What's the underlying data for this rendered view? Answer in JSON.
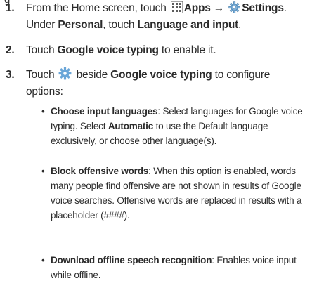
{
  "icons": {
    "apps": "apps-grid-icon",
    "settings": "settings-gear-icon",
    "configure": "configure-gear-icon"
  },
  "colors": {
    "text": "#2b2b2b",
    "apps_icon": "#5b5b5b",
    "settings_icon": "#6fa8d6",
    "configure_icon": "#6aa6d8"
  },
  "steps": [
    {
      "number": "1.",
      "line1_pre": "From the Home screen, touch ",
      "apps": "Apps",
      "arrow": " → ",
      "settings": "Settings",
      "period": ".",
      "line2_pre": "Under ",
      "personal": "Personal",
      "line2_mid": ", touch ",
      "language_input": "Language and input",
      "line2_end": "."
    },
    {
      "number": "2.",
      "pre": "Touch ",
      "gvt": "Google voice typing",
      "post": " to enable it."
    },
    {
      "number": "3.",
      "pre": "Touch ",
      "mid": " beside ",
      "gvt": "Google voice typing",
      "post": " to configure",
      "line2": "options:"
    }
  ],
  "options": [
    {
      "bullet": "•",
      "title": "Choose input languages",
      "line1_rest": ": Select languages for Google voice",
      "line2_pre": "typing. Select ",
      "line2_bold": "Automatic",
      "line2_post": " to use the Default language",
      "line3": "exclusively, or choose other language(s)."
    },
    {
      "bullet": "•",
      "title": "Block offensive words",
      "line1_rest": ": When this option is enabled, words",
      "line2": "many people find offensive are not shown in results of Google",
      "line3": "voice searches. Offensive words are replaced in results with a",
      "line4": "placeholder (####)."
    },
    {
      "bullet": "•",
      "title": "Download offline speech recognition",
      "line1_rest": ": Enables voice input",
      "line2": "while offline."
    }
  ]
}
